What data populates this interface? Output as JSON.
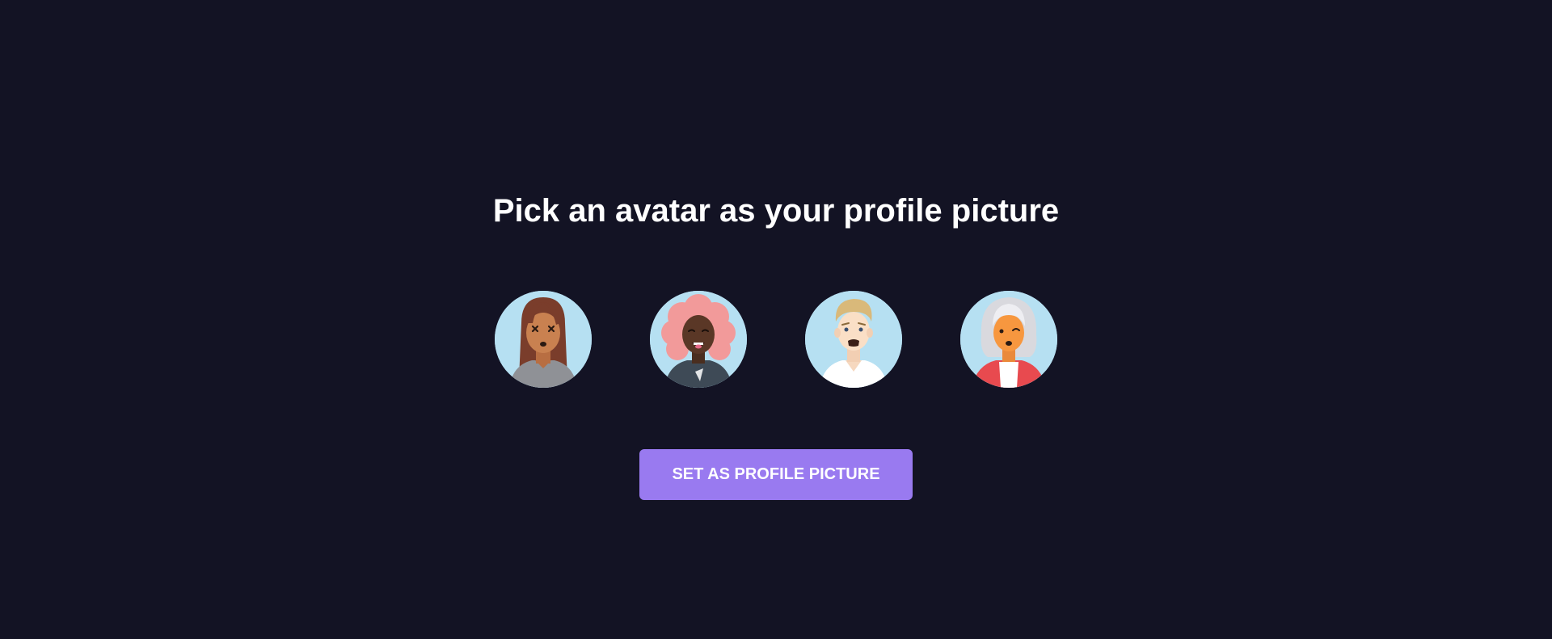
{
  "page": {
    "title": "Pick an avatar as your profile picture",
    "button_label": "SET AS PROFILE PICTURE"
  },
  "avatars": [
    {
      "name": "avatar-woman-brown-hair"
    },
    {
      "name": "avatar-woman-pink-hair"
    },
    {
      "name": "avatar-man-blonde-hair"
    },
    {
      "name": "avatar-woman-gray-hair"
    }
  ],
  "colors": {
    "background": "#131324",
    "accent": "#997af0",
    "avatar_bg": "#b6e0f2",
    "text": "#ffffff"
  }
}
